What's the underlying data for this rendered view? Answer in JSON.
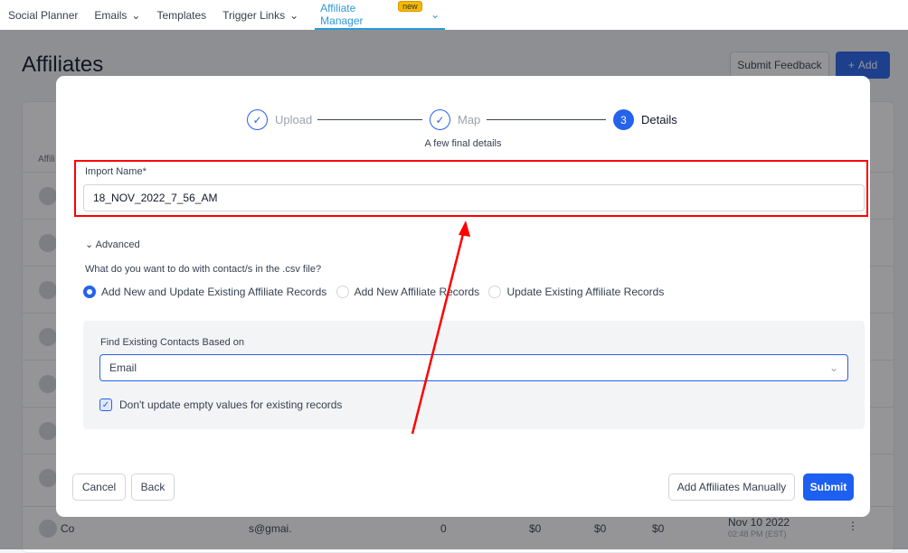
{
  "nav": {
    "items": [
      "Social Planner",
      "Emails",
      "Templates",
      "Trigger Links"
    ],
    "active": "Affiliate Manager",
    "badge": "new"
  },
  "page": {
    "title": "Affiliates",
    "feedback": "Submit Feedback",
    "add": "Add",
    "add_icon": "+"
  },
  "table": {
    "col": "Affili",
    "last_row": {
      "name": "Co",
      "email": "s@gmai.",
      "count": "0",
      "v1": "$0",
      "v2": "$0",
      "v3": "$0",
      "date": "Nov 10 2022",
      "time": "02:48 PM (EST)"
    }
  },
  "modal": {
    "steps": [
      {
        "label": "Upload",
        "icon": "check"
      },
      {
        "label": "Map",
        "icon": "check"
      },
      {
        "label": "Details",
        "num": "3"
      }
    ],
    "subtitle": "A few final details",
    "import_label": "Import Name*",
    "import_value": "18_NOV_2022_7_56_AM",
    "advanced": "Advanced",
    "question": "What do you want to do with contact/s in the .csv file?",
    "options": [
      "Add New and Update Existing Affiliate Records",
      "Add New Affiliate Records",
      "Update Existing Affiliate Records"
    ],
    "find_label": "Find Existing Contacts Based on",
    "find_value": "Email",
    "checkbox": "Don't update empty values for existing records",
    "cancel": "Cancel",
    "back": "Back",
    "manual": "Add Affiliates Manually",
    "submit": "Submit"
  },
  "colors": {
    "accent": "#2563eb",
    "annotation": "#ff0000"
  }
}
